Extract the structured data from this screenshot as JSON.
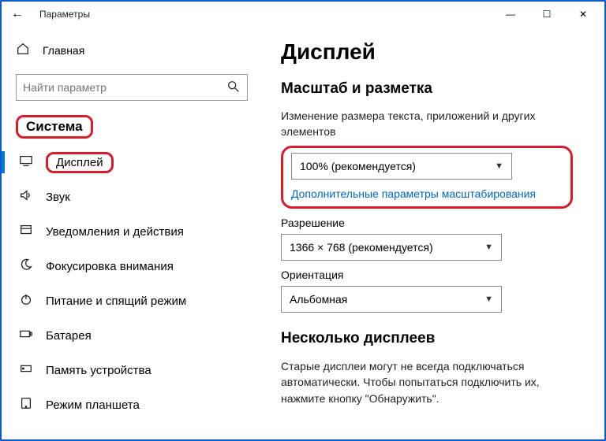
{
  "titlebar": {
    "back_glyph": "←",
    "title": "Параметры",
    "min_glyph": "—",
    "max_glyph": "☐",
    "close_glyph": "✕"
  },
  "sidebar": {
    "home_label": "Главная",
    "search_placeholder": "Найти параметр",
    "section_label": "Система",
    "items": [
      {
        "icon": "display-icon",
        "label": "Дисплей",
        "active": true
      },
      {
        "icon": "sound-icon",
        "label": "Звук"
      },
      {
        "icon": "notify-icon",
        "label": "Уведомления и действия"
      },
      {
        "icon": "moon-icon",
        "label": "Фокусировка внимания"
      },
      {
        "icon": "power-icon",
        "label": "Питание и спящий режим"
      },
      {
        "icon": "battery-icon",
        "label": "Батарея"
      },
      {
        "icon": "storage-icon",
        "label": "Память устройства"
      },
      {
        "icon": "tablet-icon",
        "label": "Режим планшета"
      }
    ]
  },
  "main": {
    "page_title": "Дисплей",
    "scale_heading": "Масштаб и разметка",
    "scale_desc": "Изменение размера текста, приложений и других элементов",
    "scale_value": "100% (рекомендуется)",
    "scale_link": "Дополнительные параметры масштабирования",
    "resolution_label": "Разрешение",
    "resolution_value": "1366 × 768 (рекомендуется)",
    "orientation_label": "Ориентация",
    "orientation_value": "Альбомная",
    "multi_heading": "Несколько дисплеев",
    "multi_desc": "Старые дисплеи могут не всегда подключаться автоматически. Чтобы попытаться подключить их, нажмите кнопку \"Обнаружить\"."
  }
}
